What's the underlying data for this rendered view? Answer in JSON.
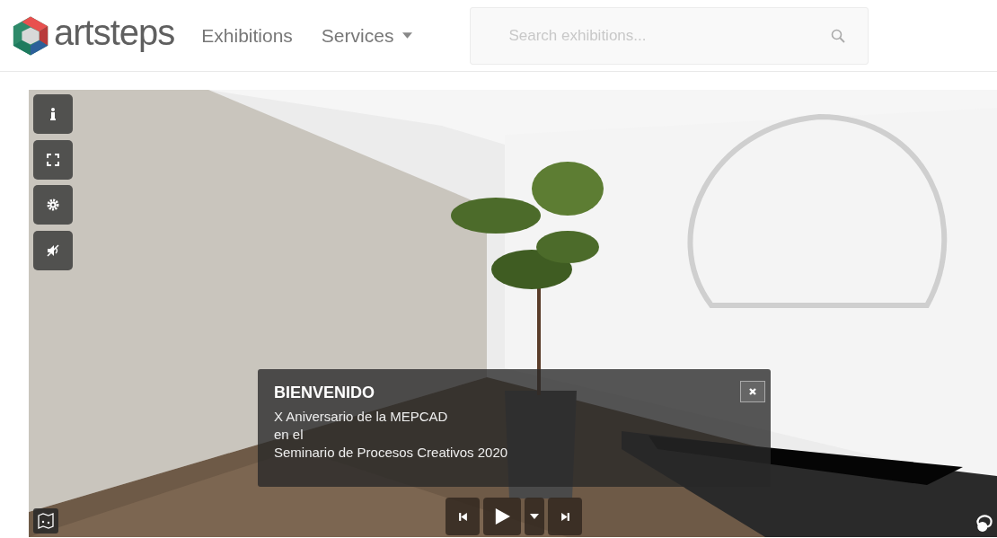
{
  "header": {
    "logo": "artsteps",
    "nav": [
      {
        "label": "Exhibitions",
        "kind": "link"
      },
      {
        "label": "Services",
        "kind": "dropdown"
      }
    ],
    "search": {
      "placeholder": "Search exhibitions..."
    }
  },
  "viewer": {
    "kind": "picture",
    "dialog": {
      "title": "BIENVENIDO",
      "lines": [
        "X Aniversario de la MEPCAD",
        "en el",
        "Seminario de Procesos Creativos 2020"
      ]
    }
  }
}
